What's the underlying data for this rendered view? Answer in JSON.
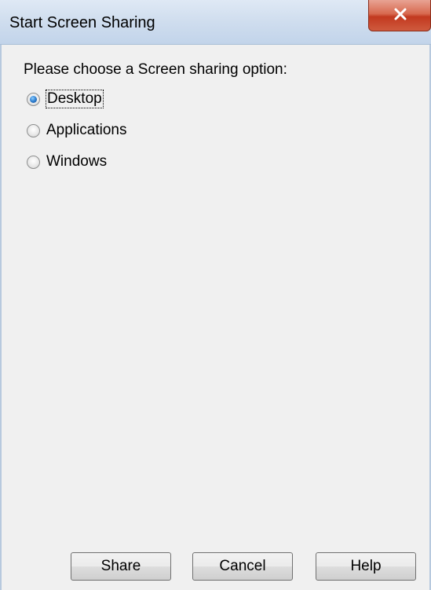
{
  "window": {
    "title": "Start Screen Sharing",
    "close_icon": "close-x-icon"
  },
  "dialog": {
    "prompt": "Please choose a Screen sharing option:",
    "options": [
      {
        "label": "Desktop",
        "checked": true
      },
      {
        "label": "Applications",
        "checked": false
      },
      {
        "label": "Windows",
        "checked": false
      }
    ]
  },
  "buttons": {
    "share": "Share",
    "cancel": "Cancel",
    "help": "Help"
  },
  "colors": {
    "close_button": "#c2391f",
    "dialog_background": "#f0f0f0",
    "title_bar": "#cfddee"
  }
}
